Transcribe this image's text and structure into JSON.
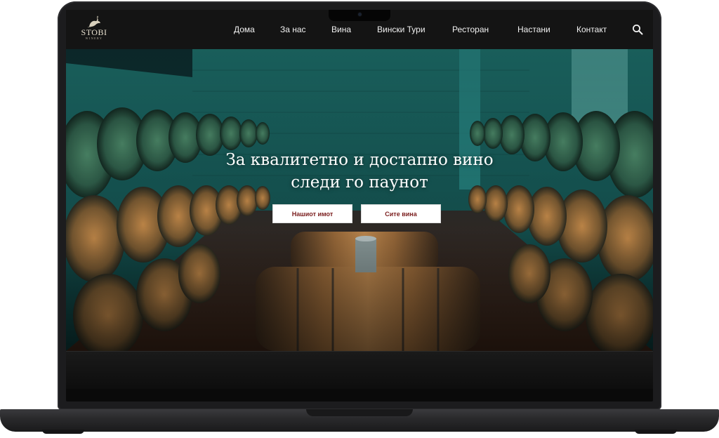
{
  "brand": {
    "name": "STOBI",
    "tagline": "WINERY"
  },
  "nav": {
    "items": [
      {
        "label": "Дома"
      },
      {
        "label": "За нас"
      },
      {
        "label": "Вина"
      },
      {
        "label": "Вински Тури"
      },
      {
        "label": "Ресторан"
      },
      {
        "label": "Настани"
      },
      {
        "label": "Контакт"
      }
    ],
    "search_icon": "search-icon"
  },
  "hero": {
    "title_line1": "За квалитетно и достапно вино",
    "title_line2": "следи го паунот",
    "buttons": {
      "estate": "Нашиот имот",
      "wines": "Сите вина"
    },
    "background": "wine cellar with oak barrels",
    "button_text_color": "#7a1d1d"
  },
  "colors": {
    "nav_bg": "#141414",
    "laptop_frame": "#1c1c1e",
    "accent": "#7a1d1d"
  }
}
